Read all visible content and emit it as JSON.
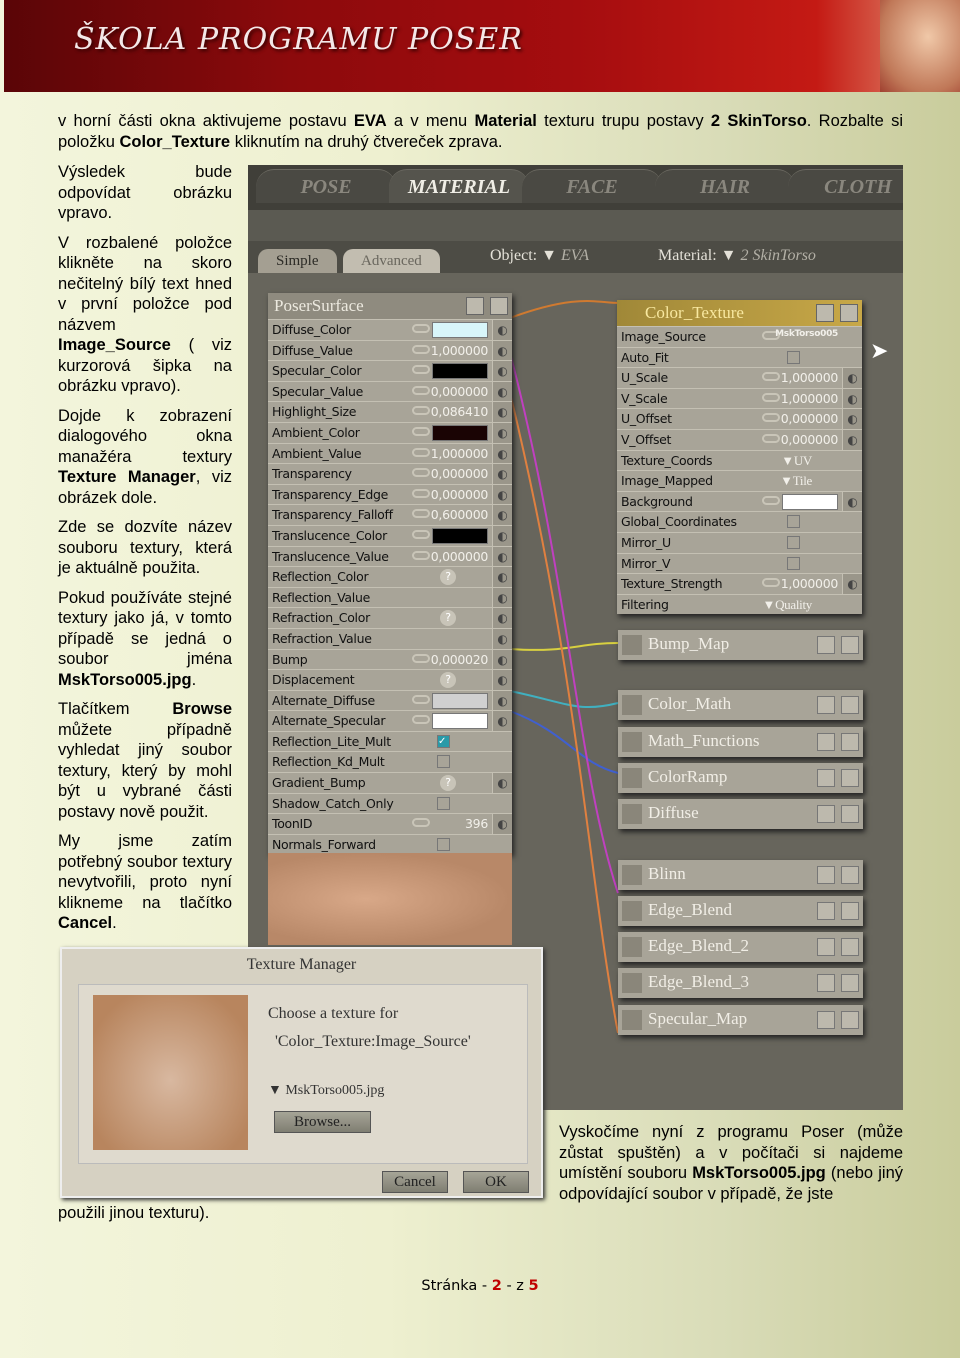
{
  "header": {
    "logo": "ŠKOLA PROGRAMU POSER"
  },
  "intro": {
    "p1": "v horní části okna aktivujeme postavu ",
    "b1": "EVA",
    "p2": " a v menu ",
    "b2": "Material",
    "p3": " texturu trupu postavy ",
    "b3": "2 SkinTorso",
    "p4": ". Rozbalte si položku ",
    "b4": "Color_Texture",
    "p5": " kliknutím na druhý čtvereček zprava."
  },
  "leftcol": [
    {
      "t": "Výsledek bude odpovídat obrázku vpravo."
    },
    {
      "t": "V rozbalené položce klikněte na skoro nečitelný bílý text hned v první položce pod názvem ",
      "b": "Image_Source",
      "t2": " ( viz kurzorová šipka na obrázku vpravo)."
    },
    {
      "t": "Dojde k zobrazení dialogového okna manažéra textury ",
      "b": "Texture Manager",
      "t2": ", viz obrázek dole."
    },
    {
      "t": "Zde se dozvíte název souboru textury, která je aktuálně použita."
    },
    {
      "t": "Pokud používáte stejné textury jako já, v tomto případě se jedná o soubor jména ",
      "b": "MskTorso005.jpg",
      "t2": "."
    },
    {
      "t": "Tlačítkem ",
      "b": "Browse",
      "t2": " můžete případně vyhledat jiný soubor textury, který by mohl být u vybrané části postavy nově použit."
    },
    {
      "t": "My jsme zatím potřebný soubor textury nevytvořili, proto nyní klikneme na tlačítko ",
      "b": "Cancel",
      "t2": "."
    }
  ],
  "right_text": {
    "t": "Vyskočíme nyní z programu Poser (může zůstat spuštěn) a v počítači si najdeme umístění souboru ",
    "b": "MskTorso005.jpg",
    "t2": " (nebo jiný odpovídající soubor v případě, že jste"
  },
  "tail_text": "použili jinou texturu).",
  "footer": {
    "pre": "Stránka - ",
    "page": "2",
    "mid": " - z ",
    "total": "5"
  },
  "poser": {
    "tabs": [
      "POSE",
      "MATERIAL",
      "FACE",
      "HAIR",
      "CLOTH"
    ],
    "active_tab": "MATERIAL",
    "subtabs": [
      "Simple",
      "Advanced"
    ],
    "object_label": "Object:",
    "object_value": "EVA",
    "material_label": "Material:",
    "material_value": "2 SkinTorso",
    "surface": {
      "title": "PoserSurface",
      "rows": [
        {
          "l": "Diffuse_Color",
          "sw": "#d8f6fa",
          "dial": true
        },
        {
          "l": "Diffuse_Value",
          "v": "1,000000",
          "dial": true
        },
        {
          "l": "Specular_Color",
          "sw": "#000000",
          "dial": true
        },
        {
          "l": "Specular_Value",
          "v": "0,000000",
          "dial": true
        },
        {
          "l": "Highlight_Size",
          "v": "0,086410",
          "dial": true
        },
        {
          "l": "Ambient_Color",
          "sw": "#1a0404",
          "dial": true
        },
        {
          "l": "Ambient_Value",
          "v": "1,000000",
          "dial": true
        },
        {
          "l": "Transparency",
          "v": "0,000000",
          "dial": true
        },
        {
          "l": "Transparency_Edge",
          "v": "0,000000",
          "dial": true
        },
        {
          "l": "Transparency_Falloff",
          "v": "0,600000",
          "dial": true
        },
        {
          "l": "Translucence_Color",
          "sw": "#000000",
          "dial": true
        },
        {
          "l": "Translucence_Value",
          "v": "0,000000",
          "dial": true
        },
        {
          "l": "Reflection_Color",
          "q": true,
          "dial": true
        },
        {
          "l": "Reflection_Value",
          "dial": true
        },
        {
          "l": "Refraction_Color",
          "q": true,
          "dial": true
        },
        {
          "l": "Refraction_Value",
          "dial": true
        },
        {
          "l": "Bump",
          "v": "0,000020",
          "dial": true
        },
        {
          "l": "Displacement",
          "q": true,
          "dial": true
        },
        {
          "l": "Alternate_Diffuse",
          "sw": "#d0d0d0",
          "dial": true
        },
        {
          "l": "Alternate_Specular",
          "sw": "#ffffff",
          "dial": true
        },
        {
          "l": "Reflection_Lite_Mult",
          "cb": true,
          "checked": true
        },
        {
          "l": "Reflection_Kd_Mult",
          "cb": true
        },
        {
          "l": "Gradient_Bump",
          "q": true,
          "dial": true
        },
        {
          "l": "Shadow_Catch_Only",
          "cb": true
        },
        {
          "l": "ToonID",
          "v": "396",
          "dial": true
        },
        {
          "l": "Normals_Forward",
          "cb": true
        }
      ]
    },
    "texture": {
      "title": "Color_Texture",
      "rows": [
        {
          "l": "Image_Source",
          "v": "MskTorso005"
        },
        {
          "l": "Auto_Fit",
          "cb": true
        },
        {
          "l": "U_Scale",
          "v": "1,000000",
          "dial": true
        },
        {
          "l": "V_Scale",
          "v": "1,000000",
          "dial": true
        },
        {
          "l": "U_Offset",
          "v": "0,000000",
          "dial": true
        },
        {
          "l": "V_Offset",
          "v": "0,000000",
          "dial": true
        },
        {
          "l": "Texture_Coords",
          "dd": "▼UV"
        },
        {
          "l": "Image_Mapped",
          "dd": "▼Tile"
        },
        {
          "l": "Background",
          "sw": "#ffffff",
          "dial": true
        },
        {
          "l": "Global_Coordinates",
          "cb": true
        },
        {
          "l": "Mirror_U",
          "cb": true
        },
        {
          "l": "Mirror_V",
          "cb": true
        },
        {
          "l": "Texture_Strength",
          "v": "1,000000",
          "dial": true
        },
        {
          "l": "Filtering",
          "dd": "▼Quality"
        }
      ]
    },
    "nodes": [
      "Bump_Map",
      "Color_Math",
      "Math_Functions",
      "ColorRamp",
      "Diffuse",
      "Blinn",
      "Edge_Blend",
      "Edge_Blend_2",
      "Edge_Blend_3",
      "Specular_Map"
    ]
  },
  "texture_manager": {
    "title": "Texture Manager",
    "line1": "Choose a texture for",
    "line2": "'Color_Texture:Image_Source'",
    "file": "MskTorso005.jpg",
    "browse": "Browse...",
    "cancel": "Cancel",
    "ok": "OK"
  }
}
